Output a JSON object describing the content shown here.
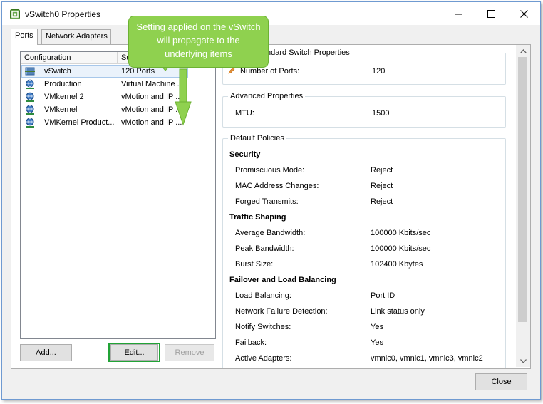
{
  "window": {
    "title": "vSwitch0 Properties"
  },
  "tabs": [
    {
      "label": "Ports",
      "active": true
    },
    {
      "label": "Network Adapters",
      "active": false
    }
  ],
  "config_list": {
    "headers": [
      "Configuration",
      "Su"
    ],
    "rows": [
      {
        "name": "vSwitch",
        "summary": "120 Ports",
        "icon": "vswitch-icon",
        "selected": true
      },
      {
        "name": "Production",
        "summary": "Virtual Machine ...",
        "icon": "network-icon",
        "selected": false
      },
      {
        "name": "VMkernel 2",
        "summary": "vMotion and IP ...",
        "icon": "network-icon",
        "selected": false
      },
      {
        "name": "VMkernel",
        "summary": "vMotion and IP ...",
        "icon": "network-icon",
        "selected": false
      },
      {
        "name": "VMKernel Product...",
        "summary": "vMotion and IP ...",
        "icon": "network-icon",
        "selected": false
      }
    ]
  },
  "buttons": {
    "add": "Add...",
    "edit": "Edit...",
    "remove": "Remove",
    "close": "Close"
  },
  "standard_switch": {
    "title": "ndard Switch Properties",
    "ports_label": "Number of Ports:",
    "ports_value": "120"
  },
  "advanced": {
    "title": "Advanced Properties",
    "mtu_label": "MTU:",
    "mtu_value": "1500"
  },
  "default_policies": {
    "title": "Default Policies",
    "security": {
      "header": "Security",
      "items": [
        {
          "label": "Promiscuous Mode:",
          "value": "Reject"
        },
        {
          "label": "MAC Address Changes:",
          "value": "Reject"
        },
        {
          "label": "Forged Transmits:",
          "value": "Reject"
        }
      ]
    },
    "traffic": {
      "header": "Traffic Shaping",
      "items": [
        {
          "label": "Average Bandwidth:",
          "value": "100000 Kbits/sec"
        },
        {
          "label": "Peak Bandwidth:",
          "value": "100000 Kbits/sec"
        },
        {
          "label": "Burst Size:",
          "value": "102400 Kbytes"
        }
      ]
    },
    "failover": {
      "header": "Failover and Load Balancing",
      "items": [
        {
          "label": "Load Balancing:",
          "value": "Port ID"
        },
        {
          "label": "Network Failure Detection:",
          "value": "Link status only"
        },
        {
          "label": "Notify Switches:",
          "value": "Yes"
        },
        {
          "label": "Failback:",
          "value": "Yes"
        },
        {
          "label": "Active Adapters:",
          "value": "vmnic0, vmnic1, vmnic3, vmnic2"
        }
      ]
    }
  },
  "callout": {
    "text": "Setting applied on the vSwitch will propagate to the underlying items"
  },
  "colors": {
    "callout_fill": "#8fd14f",
    "edit_highlight": "#21a336",
    "selection": "#eaf2fb"
  }
}
